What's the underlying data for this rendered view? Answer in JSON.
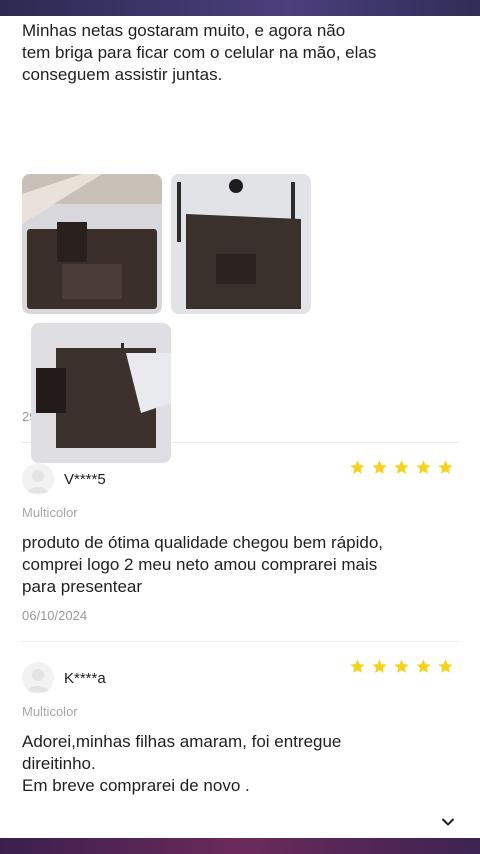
{
  "reviews": [
    {
      "text": "Minhas netas gostaram muito, e agora não\ntem briga para ficar com o celular na mão, elas\nconseguem assistir juntas.",
      "photos": [
        "review-photo-1",
        "review-photo-2",
        "review-photo-3"
      ],
      "date": "29/06/2024"
    },
    {
      "user": "V****5",
      "rating": 5,
      "variant": "Multicolor",
      "text": "produto de ótima qualidade chegou bem rápido,\ncomprei logo 2  meu neto amou  comprarei mais\npara presentear",
      "date": "06/10/2024"
    },
    {
      "user": "K****a",
      "rating": 5,
      "variant": "Multicolor",
      "text": "Adorei,minhas filhas amaram, foi entregue\ndireitinho.\nEm breve comprarei de novo ."
    }
  ],
  "colors": {
    "star": "#f7d21c",
    "date": "#9a9a9a",
    "variant": "#a8a8a8"
  },
  "icons": {
    "star": "star-icon",
    "expand": "chevron-down-icon",
    "avatar": "avatar-icon"
  }
}
